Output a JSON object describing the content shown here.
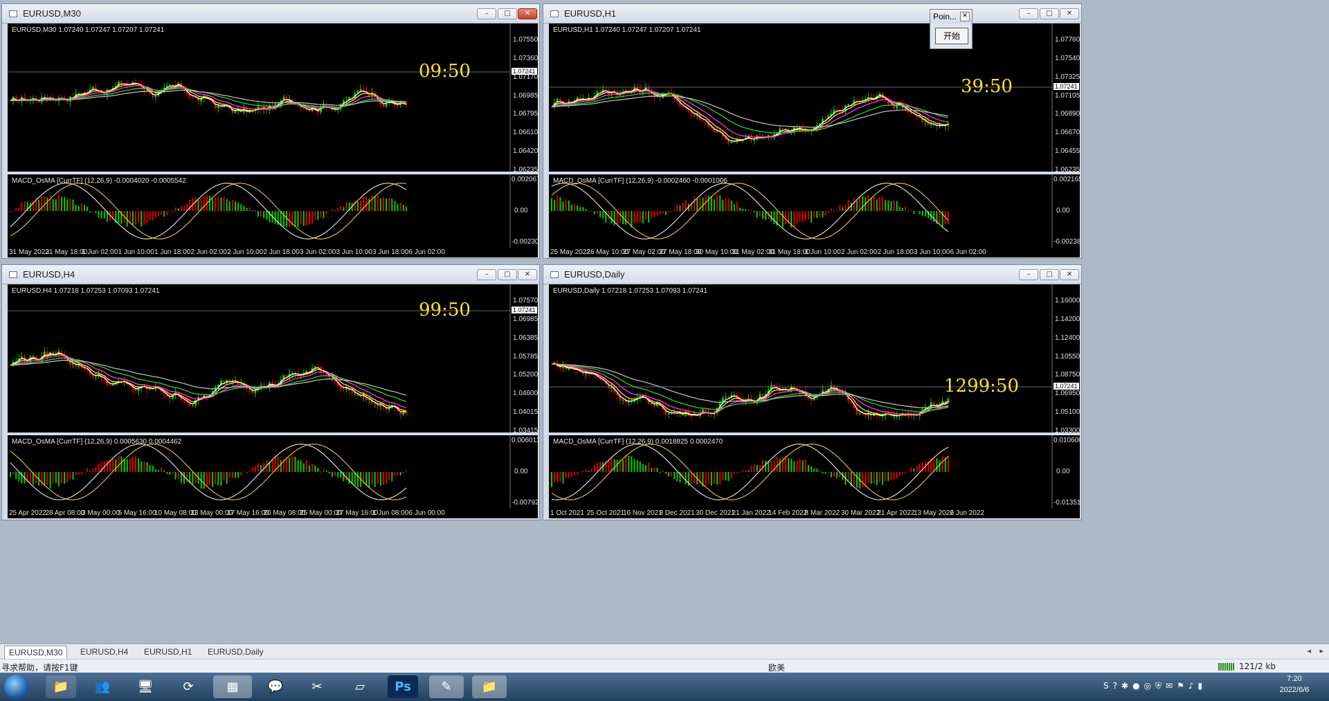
{
  "windows": [
    {
      "title": "EURUSD,M30",
      "info": "EURUSD,M30  1.07240 1.07247 1.07207 1.07241",
      "prices": [
        "1.07550",
        "1.07360",
        "1.07170",
        "1.06985",
        "1.06795",
        "1.06610",
        "1.06420",
        "1.06235"
      ],
      "price_tag": "1.07241",
      "timer": "09:50",
      "macd_label": "MACD_OsMA [CurrTF] (12,26,9) -0.0004020 -0.0005542",
      "macd_scale": [
        "0.002067",
        "0.00",
        "-0.002307"
      ],
      "times": [
        "31 May 2022",
        "31 May 18:00",
        "1 Jun 02:00",
        "1 Jun 10:00",
        "1 Jun 18:00",
        "2 Jun 02:00",
        "2 Jun 10:00",
        "2 Jun 18:00",
        "3 Jun 02:00",
        "3 Jun 10:00",
        "3 Jun 18:00",
        "6 Jun 02:00"
      ]
    },
    {
      "title": "EURUSD,H1",
      "info": "EURUSD,H1  1.07240 1.07247 1.07207 1.07241",
      "prices": [
        "1.07760",
        "1.07540",
        "1.07325",
        "1.07105",
        "1.06890",
        "1.06670",
        "1.06455",
        "1.06235"
      ],
      "price_tag": "1.07241",
      "timer": "39:50",
      "macd_label": "MACD_OsMA [CurrTF] (12,26,9) -0.0002460 -0.0001006",
      "macd_scale": [
        "0.0021659",
        "0.00",
        "-0.002386"
      ],
      "times": [
        "25 May 2022",
        "26 May 10:00",
        "27 May 02:00",
        "27 May 18:00",
        "30 May 10:00",
        "31 May 02:00",
        "31 May 18:00",
        "1 Jun 10:00",
        "2 Jun 02:00",
        "2 Jun 18:00",
        "3 Jun 10:00",
        "6 Jun 02:00"
      ]
    },
    {
      "title": "EURUSD,H4",
      "info": "EURUSD,H4  1.07218 1.07253 1.07093 1.07241",
      "prices": [
        "1.07570",
        "1.06985",
        "1.06385",
        "1.05785",
        "1.05200",
        "1.04600",
        "1.04015",
        "1.03415"
      ],
      "price_tag": "1.07241",
      "timer": "99:50",
      "macd_label": "MACD_OsMA [CurrTF] (12,26,9) 0.0005630 0.0004462",
      "macd_scale": [
        "0.0060137",
        "0.00",
        "-0.007929"
      ],
      "times": [
        "25 Apr 2022",
        "28 Apr 08:00",
        "3 May 00:00",
        "5 May 16:00",
        "10 May 08:00",
        "13 May 00:00",
        "17 May 16:00",
        "20 May 08:00",
        "25 May 00:00",
        "27 May 16:00",
        "1 Jun 08:00",
        "6 Jun 00:00"
      ]
    },
    {
      "title": "EURUSD,Daily",
      "info": "EURUSD,Daily  1.07218 1.07253 1.07093 1.07241",
      "prices": [
        "1.16000",
        "1.14200",
        "1.12400",
        "1.10550",
        "1.08750",
        "1.06950",
        "1.05100",
        "1.03300"
      ],
      "price_tag": "1.07241",
      "timer": "1299:50",
      "macd_label": "MACD_OsMA [CurrTF] (12,26,9) 0.0018825 0.0002470",
      "macd_scale": [
        "0.0106004",
        "0.00",
        "-0.013515"
      ],
      "times": [
        "1 Oct 2021",
        "25 Oct 2021",
        "16 Nov 2021",
        "8 Dec 2021",
        "30 Dec 2021",
        "21 Jan 2022",
        "14 Feb 2022",
        "8 Mar 2022",
        "30 Mar 2022",
        "21 Apr 2022",
        "13 May 2022",
        "6 Jun 2022"
      ]
    }
  ],
  "popup": {
    "title": "Poin...",
    "button": "开始"
  },
  "tabs": [
    "EURUSD,M30",
    "EURUSD,H4",
    "EURUSD,H1",
    "EURUSD,Daily"
  ],
  "status": {
    "help": "寻求帮助，请按F1键",
    "profile": "欧美",
    "traffic": "121/2 kb"
  },
  "clock": {
    "time": "7:20",
    "date": "2022/6/6"
  },
  "colors": {
    "bull": "#00d000",
    "bear": "#e00000",
    "ma_white": "#ffffff",
    "ma_yellow": "#ffe12e",
    "ma_magenta": "#ff30ff",
    "ma_green": "#30d030",
    "ma_gray": "#b8b8b8"
  }
}
